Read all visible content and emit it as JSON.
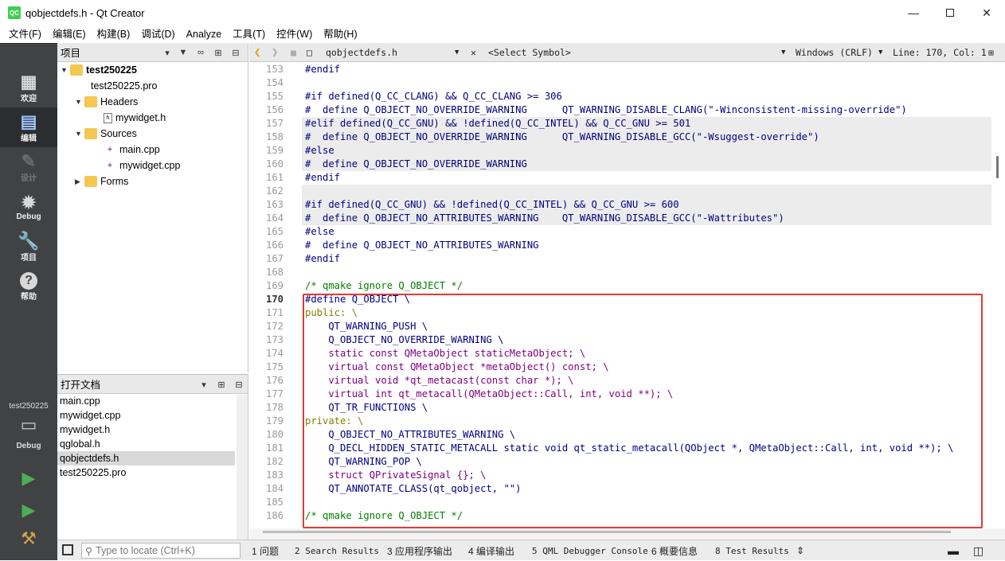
{
  "window": {
    "title": "qobjectdefs.h - Qt Creator",
    "app_icon": "QC"
  },
  "menu": [
    "文件(F)",
    "编辑(E)",
    "构建(B)",
    "调试(D)",
    "Analyze",
    "工具(T)",
    "控件(W)",
    "帮助(H)"
  ],
  "modes": [
    {
      "label": "欢迎",
      "icon": "grid-icon"
    },
    {
      "label": "编辑",
      "icon": "document-icon"
    },
    {
      "label": "设计",
      "icon": "pencil-icon"
    },
    {
      "label": "Debug",
      "icon": "bug-icon"
    },
    {
      "label": "项目",
      "icon": "wrench-icon"
    },
    {
      "label": "帮助",
      "icon": "help-icon"
    }
  ],
  "kit": {
    "name": "test250225",
    "build": "Debug"
  },
  "project_pane": {
    "title": "项目",
    "tree": [
      {
        "label": "test250225"
      },
      {
        "label": "test250225.pro"
      },
      {
        "label": "Headers"
      },
      {
        "label": "mywidget.h"
      },
      {
        "label": "Sources"
      },
      {
        "label": "main.cpp"
      },
      {
        "label": "mywidget.cpp"
      },
      {
        "label": "Forms"
      }
    ]
  },
  "open_docs": {
    "title": "打开文档",
    "items": [
      "main.cpp",
      "mywidget.cpp",
      "mywidget.h",
      "qglobal.h",
      "qobjectdefs.h",
      "test250225.pro"
    ],
    "selected_index": 4
  },
  "editor": {
    "file": "qobjectdefs.h",
    "symbol": "<Select Symbol>",
    "encoding": "Windows (CRLF)",
    "position": "Line: 170, Col: 1",
    "current_line": 170
  },
  "code_lines": [
    {
      "n": "153",
      "t": ""
    },
    {
      "n": "154",
      "t": "#endif"
    },
    {
      "n": "155",
      "t": ""
    },
    {
      "n": "156",
      "t": "#if defined(Q_CC_CLANG) && Q_CC_CLANG >= 306"
    },
    {
      "n": "157",
      "t": "#  define Q_OBJECT_NO_OVERRIDE_WARNING      QT_WARNING_DISABLE_CLANG(\"-Winconsistent-missing-override\")"
    },
    {
      "n": "158",
      "t": "#elif defined(Q_CC_GNU) && !defined(Q_CC_INTEL) && Q_CC_GNU >= 501"
    },
    {
      "n": "159",
      "t": "#  define Q_OBJECT_NO_OVERRIDE_WARNING      QT_WARNING_DISABLE_GCC(\"-Wsuggest-override\")"
    },
    {
      "n": "160",
      "t": "#else"
    },
    {
      "n": "161",
      "t": "#  define Q_OBJECT_NO_OVERRIDE_WARNING"
    },
    {
      "n": "162",
      "t": "#endif"
    },
    {
      "n": "163",
      "t": ""
    },
    {
      "n": "164",
      "t": "#if defined(Q_CC_GNU) && !defined(Q_CC_INTEL) && Q_CC_GNU >= 600"
    },
    {
      "n": "165",
      "t": "#  define Q_OBJECT_NO_ATTRIBUTES_WARNING    QT_WARNING_DISABLE_GCC(\"-Wattributes\")"
    },
    {
      "n": "166",
      "t": "#else"
    },
    {
      "n": "167",
      "t": "#  define Q_OBJECT_NO_ATTRIBUTES_WARNING"
    },
    {
      "n": "168",
      "t": "#endif"
    },
    {
      "n": "169",
      "t": ""
    },
    {
      "n": "170",
      "t": "/* qmake ignore Q_OBJECT */"
    },
    {
      "n": "171",
      "t": "#define Q_OBJECT \\"
    },
    {
      "n": "172",
      "t": "public: \\"
    },
    {
      "n": "173",
      "t": "    QT_WARNING_PUSH \\"
    },
    {
      "n": "174",
      "t": "    Q_OBJECT_NO_OVERRIDE_WARNING \\"
    },
    {
      "n": "175",
      "t": "    static const QMetaObject staticMetaObject; \\"
    },
    {
      "n": "176",
      "t": "    virtual const QMetaObject *metaObject() const; \\"
    },
    {
      "n": "177",
      "t": "    virtual void *qt_metacast(const char *); \\"
    },
    {
      "n": "178",
      "t": "    virtual int qt_metacall(QMetaObject::Call, int, void **); \\"
    },
    {
      "n": "179",
      "t": "    QT_TR_FUNCTIONS \\"
    },
    {
      "n": "180",
      "t": "private: \\"
    },
    {
      "n": "181",
      "t": "    Q_OBJECT_NO_ATTRIBUTES_WARNING \\"
    },
    {
      "n": "182",
      "t": "    Q_DECL_HIDDEN_STATIC_METACALL static void qt_static_metacall(QObject *, QMetaObject::Call, int, void **); \\"
    },
    {
      "n": "183",
      "t": "    QT_WARNING_POP \\"
    },
    {
      "n": "184",
      "t": "    struct QPrivateSignal {}; \\"
    },
    {
      "n": "185",
      "t": "    QT_ANNOTATE_CLASS(qt_qobject, \"\")"
    },
    {
      "n": "186",
      "t": ""
    },
    {
      "n": "",
      "t": "/* qmake ignore Q_OBJECT */"
    }
  ],
  "status": {
    "locator_placeholder": "Type to locate (Ctrl+K)",
    "tabs": [
      "1 问题",
      "2 Search Results",
      "3 应用程序输出",
      "4 编译输出",
      "5 QML Debugger Console",
      "6 概要信息",
      "8 Test Results"
    ]
  }
}
